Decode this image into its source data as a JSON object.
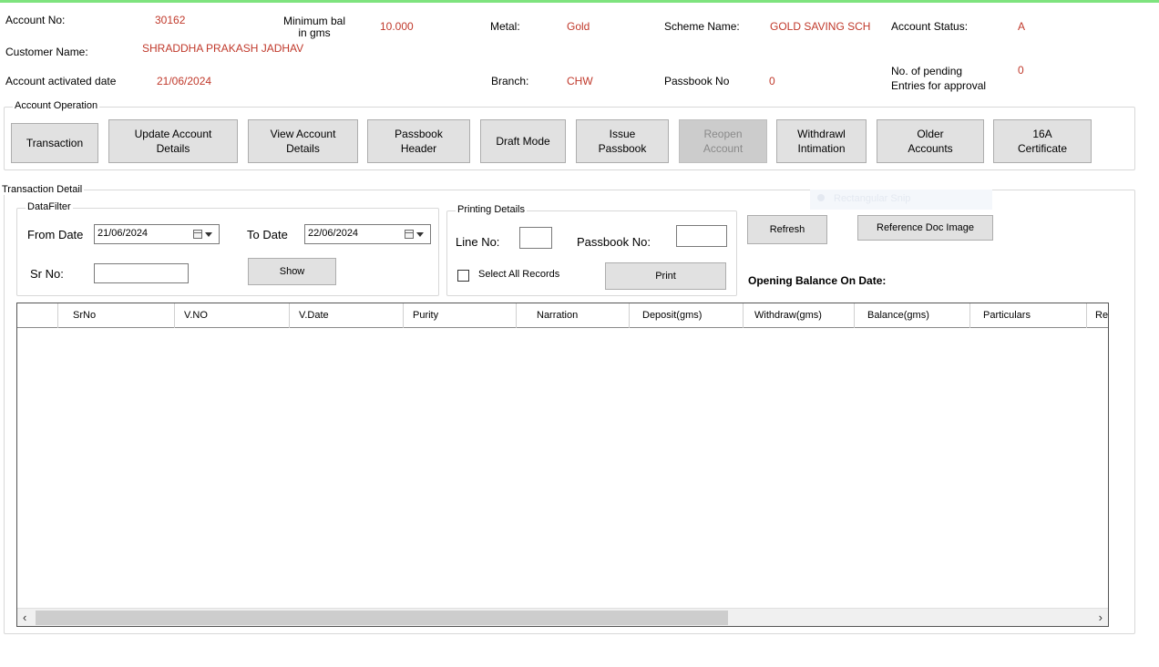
{
  "header": {
    "account_no_label": "Account No:",
    "account_no_value": "30162",
    "min_bal_label": "Minimum bal\nin gms",
    "min_bal_value": "10.000",
    "metal_label": "Metal:",
    "metal_value": "Gold",
    "scheme_label": "Scheme Name:",
    "scheme_value": "GOLD SAVING SCH",
    "account_status_label": "Account Status:",
    "account_status_value": "A",
    "customer_name_label": "Customer Name:",
    "customer_name_value": "SHRADDHA PRAKASH JADHAV",
    "activated_label": "Account activated date",
    "activated_value": "21/06/2024",
    "branch_label": "Branch:",
    "branch_value": "CHW",
    "passbook_label": "Passbook No",
    "passbook_value": "0",
    "pending_label": "No. of pending\nEntries for approval",
    "pending_value": "0"
  },
  "account_operation": {
    "title": "Account Operation",
    "buttons": {
      "transaction": "Transaction",
      "update_details": "Update Account\nDetails",
      "view_details": "View Account\nDetails",
      "passbook_header": "Passbook\nHeader",
      "draft_mode": "Draft Mode",
      "issue_passbook": "Issue\nPassbook",
      "reopen_account": "Reopen\nAccount",
      "withdrawl_intimation": "Withdrawl\nIntimation",
      "older_accounts": "Older\nAccounts",
      "certificate_16a": "16A\nCertificate"
    }
  },
  "transaction_detail": {
    "title": "Transaction Detail",
    "datafilter": {
      "title": "DataFilter",
      "from_date_label": "From Date",
      "from_date_value": "21/06/2024",
      "to_date_label": "To Date",
      "to_date_value": "22/06/2024",
      "sr_no_label": "Sr No:",
      "sr_no_value": "",
      "show_button": "Show"
    },
    "printing": {
      "title": "Printing Details",
      "line_no_label": "Line No:",
      "line_no_value": "",
      "passbook_no_label": "Passbook No:",
      "passbook_no_value": "",
      "select_all_label": "Select All Records",
      "select_all_checked": false,
      "print_button": "Print"
    },
    "refresh_button": "Refresh",
    "reference_doc_button": "Reference Doc Image",
    "opening_balance_label": "Opening Balance On Date:",
    "ghost_tooltip": "Rectangular Snip"
  },
  "grid": {
    "columns": [
      "",
      "SrNo",
      "V.NO",
      "V.Date",
      "Purity",
      "Narration",
      "Deposit(gms)",
      "Withdraw(gms)",
      "Balance(gms)",
      "Particulars",
      "Re"
    ],
    "rows": []
  }
}
